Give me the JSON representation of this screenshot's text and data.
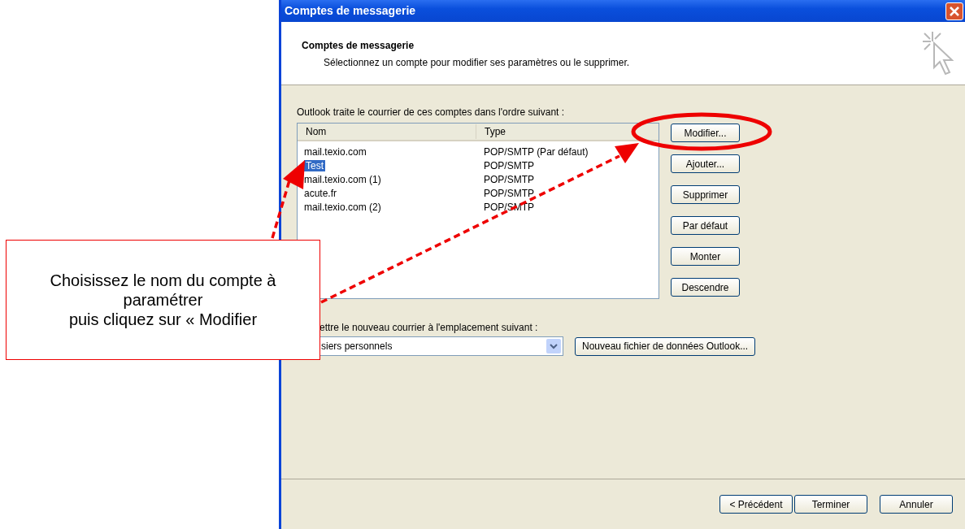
{
  "window": {
    "title": "Comptes de messagerie"
  },
  "header": {
    "title": "Comptes de messagerie",
    "subtitle": "Sélectionnez un compte pour modifier ses paramètres ou le supprimer."
  },
  "accounts": {
    "label": "Outlook traite le courrier de ces comptes dans l'ordre suivant :",
    "columns": [
      "Nom",
      "Type"
    ],
    "rows": [
      {
        "name": "mail.texio.com",
        "type": "POP/SMTP (Par défaut)",
        "selected": false
      },
      {
        "name": "Test",
        "type": "POP/SMTP",
        "selected": true
      },
      {
        "name": "mail.texio.com (1)",
        "type": "POP/SMTP",
        "selected": false
      },
      {
        "name": "acute.fr",
        "type": "POP/SMTP",
        "selected": false
      },
      {
        "name": "mail.texio.com (2)",
        "type": "POP/SMTP",
        "selected": false
      }
    ]
  },
  "side_buttons": [
    "Modifier...",
    "Ajouter...",
    "Supprimer",
    "Par défaut",
    "Monter",
    "Descendre"
  ],
  "delivery": {
    "label": "ettre le nouveau courrier à l'emplacement suivant :",
    "value": "siers personnels",
    "new_file_button": "Nouveau fichier de données Outlook..."
  },
  "footer_buttons": [
    "< Précédent",
    "Terminer",
    "Annuler"
  ],
  "callout": {
    "lines": [
      "Choisissez le nom du compte à",
      "paramétrer",
      "puis cliquez sur « Modifier"
    ]
  }
}
